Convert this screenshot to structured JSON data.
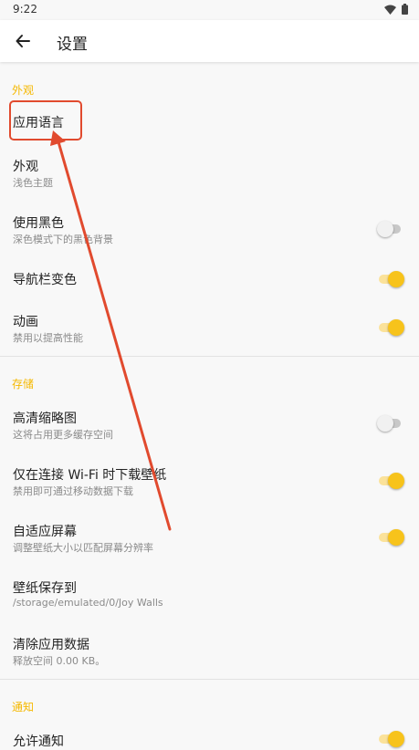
{
  "status": {
    "time": "9:22"
  },
  "header": {
    "title": "设置",
    "back_icon": "arrow-left-icon"
  },
  "sections": {
    "appearance": "外观",
    "storage": "存储",
    "notifications": "通知"
  },
  "items": {
    "app_language": {
      "title": "应用语言"
    },
    "appearance": {
      "title": "外观",
      "subtitle": "浅色主题"
    },
    "use_black": {
      "title": "使用黑色",
      "subtitle": "深色模式下的黑色背景",
      "enabled": false
    },
    "navbar_color": {
      "title": "导航栏变色",
      "enabled": true
    },
    "animation": {
      "title": "动画",
      "subtitle": "禁用以提高性能",
      "enabled": true
    },
    "hd_thumbnails": {
      "title": "高清缩略图",
      "subtitle": "这将占用更多缓存空间",
      "enabled": false
    },
    "wifi_only": {
      "title": "仅在连接 Wi-Fi 时下载壁纸",
      "subtitle": "禁用即可通过移动数据下载",
      "enabled": true
    },
    "adaptive_screen": {
      "title": "自适应屏幕",
      "subtitle": "调整壁纸大小以匹配屏幕分辨率",
      "enabled": true
    },
    "save_location": {
      "title": "壁纸保存到",
      "subtitle": "/storage/emulated/0/Joy Walls"
    },
    "clear_data": {
      "title": "清除应用数据",
      "subtitle": "释放空间 0.00 KB。"
    },
    "allow_notifications": {
      "title": "允许通知",
      "enabled": true
    }
  },
  "colors": {
    "accent": "#f7c31b",
    "section_header": "#f5b800",
    "annotation": "#e14a2e"
  }
}
